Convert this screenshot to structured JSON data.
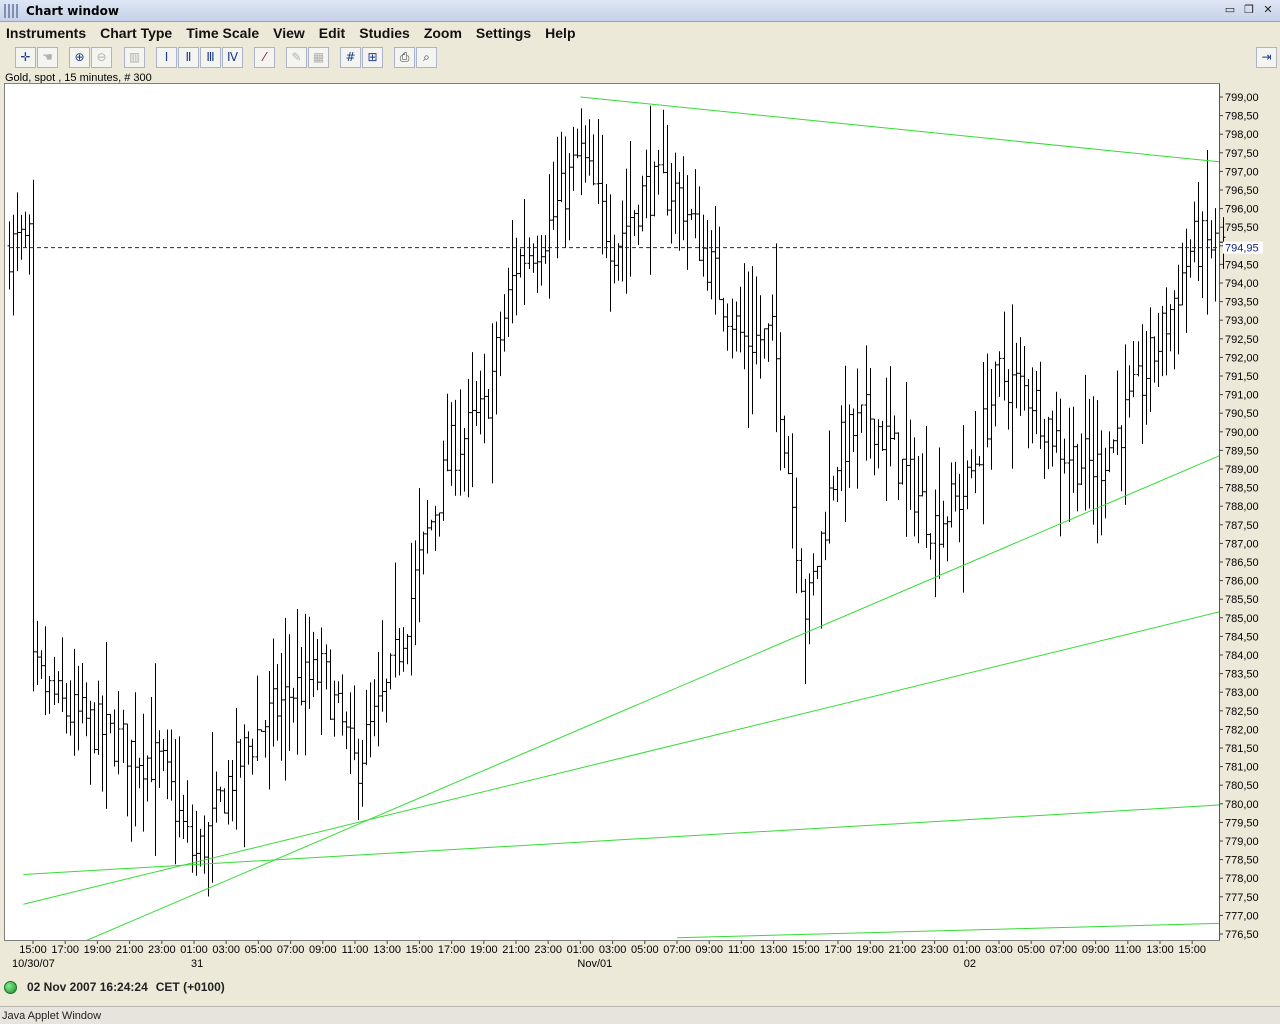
{
  "window": {
    "title": "Chart window"
  },
  "menu": [
    "Instruments",
    "Chart Type",
    "Time Scale",
    "View",
    "Edit",
    "Studies",
    "Zoom",
    "Settings",
    "Help"
  ],
  "toolbar_icons": [
    "crosshair-icon",
    "hand-pointer-icon",
    "zoom-in-icon",
    "zoom-out-icon",
    "bar-chart-icon",
    "bars-1-icon",
    "bars-2-icon",
    "bars-3-icon",
    "bars-4-icon",
    "trend-line-icon",
    "pencil-icon",
    "grid-remove-icon",
    "grid-icon",
    "grid-scale-icon",
    "print-icon",
    "print-preview-icon",
    "dock-icon"
  ],
  "chart_label": "Gold, spot , 15 minutes, # 300",
  "status": {
    "datetime": "02 Nov 2007 16:24:24",
    "timezone": "CET (+0100)"
  },
  "applet_label": "Java Applet Window",
  "chart_data": {
    "type": "bar",
    "instrument": "Gold, spot",
    "interval": "15 minutes",
    "bars": 300,
    "current_price": "794,95",
    "ylim": [
      776.5,
      799.0
    ],
    "y_ticks": [
      "799,00",
      "798,50",
      "798,00",
      "797,50",
      "797,00",
      "796,50",
      "796,00",
      "795,50",
      "795,00",
      "794,50",
      "794,00",
      "793,50",
      "793,00",
      "792,50",
      "792,00",
      "791,50",
      "791,00",
      "790,50",
      "790,00",
      "789,50",
      "789,00",
      "788,50",
      "788,00",
      "787,50",
      "787,00",
      "786,50",
      "786,00",
      "785,50",
      "785,00",
      "784,50",
      "784,00",
      "783,50",
      "783,00",
      "782,50",
      "782,00",
      "781,50",
      "781,00",
      "780,50",
      "780,00",
      "779,50",
      "779,00",
      "778,50",
      "778,00",
      "777,50",
      "777,00",
      "776,50"
    ],
    "x_ticks": [
      "15:00",
      "17:00",
      "19:00",
      "21:00",
      "23:00",
      "01:00",
      "03:00",
      "05:00",
      "07:00",
      "09:00",
      "11:00",
      "13:00",
      "15:00",
      "17:00",
      "19:00",
      "21:00",
      "23:00",
      "01:00",
      "03:00",
      "05:00",
      "07:00",
      "09:00",
      "11:00",
      "13:00",
      "15:00",
      "17:00",
      "19:00",
      "21:00",
      "23:00",
      "01:00",
      "03:00",
      "05:00",
      "07:00",
      "09:00",
      "11:00",
      "13:00",
      "15:00"
    ],
    "date_labels": [
      {
        "label": "10/30/07",
        "tick_index": 0
      },
      {
        "label": "31",
        "tick_index": 5
      },
      {
        "label": "Nov/01",
        "tick_index": 17
      },
      {
        "label": "02",
        "tick_index": 29
      }
    ],
    "price_path": [
      {
        "t": 0,
        "p": 783.5
      },
      {
        "t": 1,
        "p": 782.5
      },
      {
        "t": 2,
        "p": 782.0
      },
      {
        "t": 3,
        "p": 781.5
      },
      {
        "t": 4,
        "p": 781.0
      },
      {
        "t": 5,
        "p": 778.5
      },
      {
        "t": 5.5,
        "p": 779.3
      },
      {
        "t": 6,
        "p": 780.5
      },
      {
        "t": 7,
        "p": 782.0
      },
      {
        "t": 8,
        "p": 783.0
      },
      {
        "t": 9,
        "p": 783.5
      },
      {
        "t": 10,
        "p": 781.0
      },
      {
        "t": 11,
        "p": 783.0
      },
      {
        "t": 12,
        "p": 786.5
      },
      {
        "t": 13,
        "p": 789.5
      },
      {
        "t": 14,
        "p": 790.5
      },
      {
        "t": 15,
        "p": 794.5
      },
      {
        "t": 16,
        "p": 795.5
      },
      {
        "t": 17,
        "p": 797.5
      },
      {
        "t": 18,
        "p": 795.0
      },
      {
        "t": 19,
        "p": 796.5
      },
      {
        "t": 20,
        "p": 796.5
      },
      {
        "t": 21,
        "p": 794.5
      },
      {
        "t": 22,
        "p": 792.5
      },
      {
        "t": 23,
        "p": 792.5
      },
      {
        "t": 24,
        "p": 785.0
      },
      {
        "t": 25,
        "p": 789.5
      },
      {
        "t": 26,
        "p": 790.5
      },
      {
        "t": 27,
        "p": 789.0
      },
      {
        "t": 28,
        "p": 787.5
      },
      {
        "t": 29,
        "p": 788.5
      },
      {
        "t": 30,
        "p": 791.5
      },
      {
        "t": 31,
        "p": 791.0
      },
      {
        "t": 32,
        "p": 789.5
      },
      {
        "t": 33,
        "p": 789.0
      },
      {
        "t": 34,
        "p": 790.5
      },
      {
        "t": 35,
        "p": 792.5
      },
      {
        "t": 36,
        "p": 795.0
      }
    ],
    "trend_lines": [
      {
        "t1": 17.0,
        "p1": 799.0,
        "t2": 37.5,
        "p2": 797.2
      },
      {
        "t1": -0.3,
        "p1": 775.6,
        "t2": 37.5,
        "p2": 789.6
      },
      {
        "t1": -0.3,
        "p1": 777.3,
        "t2": 37.5,
        "p2": 785.3
      },
      {
        "t1": -0.3,
        "p1": 778.1,
        "t2": 37.5,
        "p2": 780.0
      },
      {
        "t1": 20.0,
        "p1": 776.4,
        "t2": 37.5,
        "p2": 776.8
      }
    ],
    "colors": {
      "bars": "#000000",
      "trend": "#33dd33",
      "price_line": "#1a237e",
      "price_label": "#1a237e"
    }
  }
}
